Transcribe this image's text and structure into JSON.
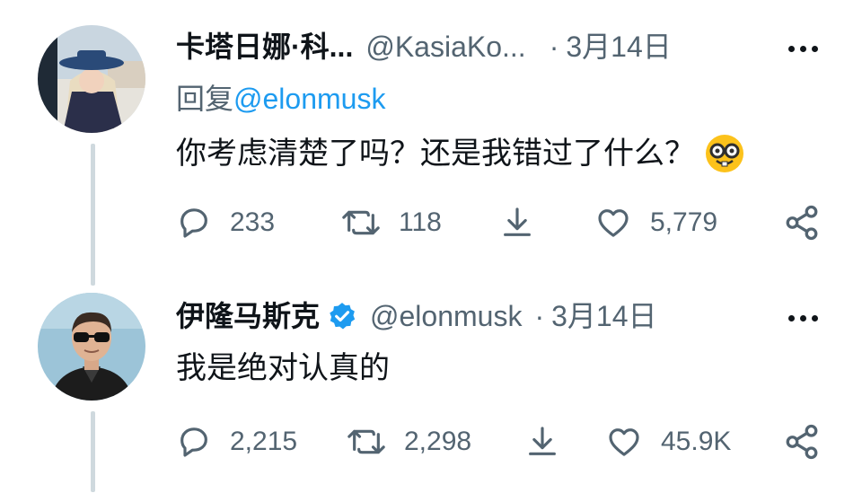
{
  "tweets": [
    {
      "author_name": "卡塔日娜·科...",
      "handle": "@KasiaKo...",
      "separator": "·",
      "date": "3月14日",
      "verified": false,
      "reply_prefix": "回复",
      "reply_mention": "@elonmusk",
      "text": "你考虑清楚了吗？还是我错过了什么？",
      "emoji": "nerd-face-emoji",
      "counts": {
        "replies": "233",
        "retweets": "118",
        "likes": "5,779"
      }
    },
    {
      "author_name": "伊隆马斯克",
      "handle": "@elonmusk",
      "separator": "·",
      "date": "3月14日",
      "verified": true,
      "text": "我是绝对认真的",
      "counts": {
        "replies": "2,215",
        "retweets": "2,298",
        "likes": "45.9K"
      }
    }
  ],
  "icons": [
    "more-icon",
    "reply-icon",
    "retweet-icon",
    "download-icon",
    "like-icon",
    "share-icon",
    "verified-badge-icon"
  ],
  "colors": {
    "text": "#0f1419",
    "secondary": "#536471",
    "link": "#1d9bf0",
    "thread_line": "#cfd9de",
    "verified": "#1d9bf0"
  }
}
